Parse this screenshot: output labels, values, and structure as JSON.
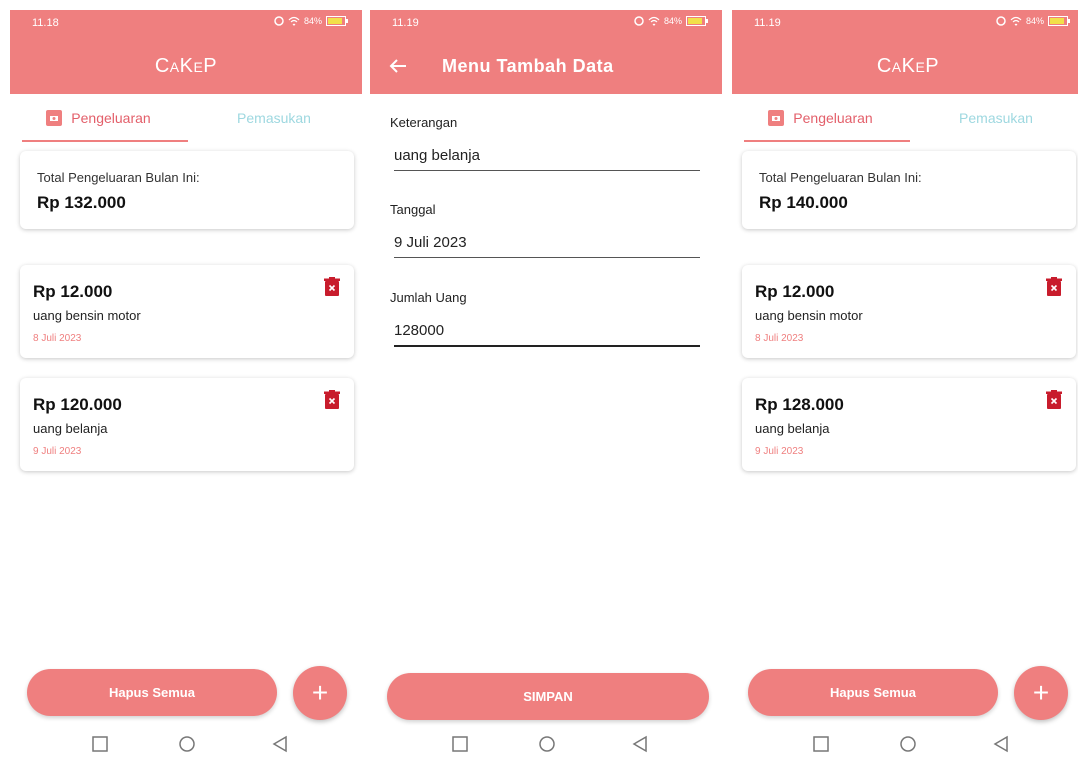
{
  "accent_color": "#ef7f7f",
  "screens": {
    "list1": {
      "status": {
        "time": "11.18",
        "battery": "84%"
      },
      "app_title": "CaKeP",
      "tabs": [
        {
          "label": "Pengeluaran"
        },
        {
          "label": "Pemasukan"
        }
      ],
      "summary": {
        "label": "Total Pengeluaran Bulan Ini:",
        "value": "Rp 132.000"
      },
      "items": [
        {
          "amount": "Rp 12.000",
          "desc": "uang bensin motor",
          "date": "8 Juli 2023"
        },
        {
          "amount": "Rp 120.000",
          "desc": "uang belanja",
          "date": "9 Juli 2023"
        }
      ],
      "delete_all_label": "Hapus Semua",
      "fab_label": "+"
    },
    "form": {
      "status": {
        "time": "11.19",
        "battery": "84%"
      },
      "title": "Menu Tambah Data",
      "fields": [
        {
          "label": "Keterangan",
          "value": "uang belanja"
        },
        {
          "label": "Tanggal",
          "value": "9 Juli 2023"
        },
        {
          "label": "Jumlah Uang",
          "value": "128000"
        }
      ],
      "save_label": "SIMPAN"
    },
    "list2": {
      "status": {
        "time": "11.19",
        "battery": "84%"
      },
      "app_title": "CaKeP",
      "tabs": [
        {
          "label": "Pengeluaran"
        },
        {
          "label": "Pemasukan"
        }
      ],
      "summary": {
        "label": "Total Pengeluaran Bulan Ini:",
        "value": "Rp 140.000"
      },
      "items": [
        {
          "amount": "Rp 12.000",
          "desc": "uang bensin motor",
          "date": "8 Juli 2023"
        },
        {
          "amount": "Rp 128.000",
          "desc": "uang belanja",
          "date": "9 Juli 2023"
        }
      ],
      "delete_all_label": "Hapus Semua",
      "fab_label": "+"
    }
  },
  "icons": {
    "tab_icon": "wallet-icon",
    "delete": "trash-icon",
    "back": "arrow-left-icon",
    "nav": [
      "square-icon",
      "circle-icon",
      "triangle-back-icon"
    ]
  }
}
